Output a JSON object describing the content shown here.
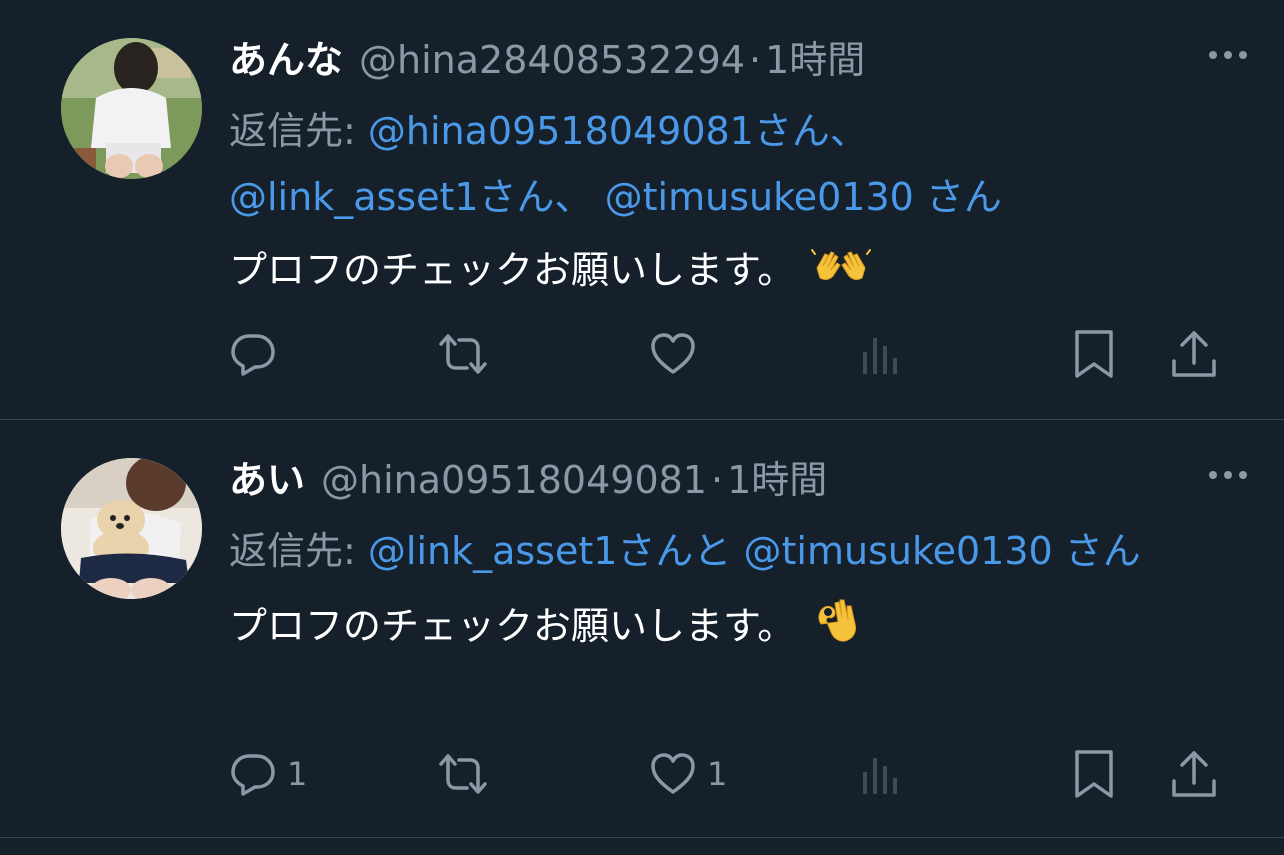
{
  "tweets": [
    {
      "display_name": "あんな",
      "handle": "@hina28408532294",
      "separator": "·",
      "time": "1時間",
      "reply_label": "返信先: ",
      "reply_mentions": [
        {
          "text": "@hina09518049081さん、"
        },
        {
          "text": "@link_asset1さん、"
        },
        {
          "text": "@timusuke0130 さん"
        }
      ],
      "text": "プロフのチェックお願いします。",
      "emoji": "clapping-hands-emoji",
      "reply_count": "",
      "retweet_count": "",
      "like_count": ""
    },
    {
      "display_name": "あい",
      "handle": "@hina09518049081",
      "separator": "·",
      "time": "1時間",
      "reply_label": "返信先: ",
      "reply_mentions": [
        {
          "text": "@link_asset1さんと"
        },
        {
          "text": "@timusuke0130 さん"
        }
      ],
      "text": "プロフのチェックお願いします。",
      "emoji": "ok-hand-emoji",
      "reply_count": "1",
      "retweet_count": "",
      "like_count": "1"
    }
  ],
  "icons": {
    "more": "more-icon",
    "reply": "reply-icon",
    "retweet": "retweet-icon",
    "like": "heart-icon",
    "views": "views-icon",
    "bookmark": "bookmark-icon",
    "share": "share-icon"
  },
  "colors": {
    "background": "#15202b",
    "text": "#ffffff",
    "muted": "#8b98a5",
    "mention": "#4a99e9",
    "divider": "#38444d"
  }
}
